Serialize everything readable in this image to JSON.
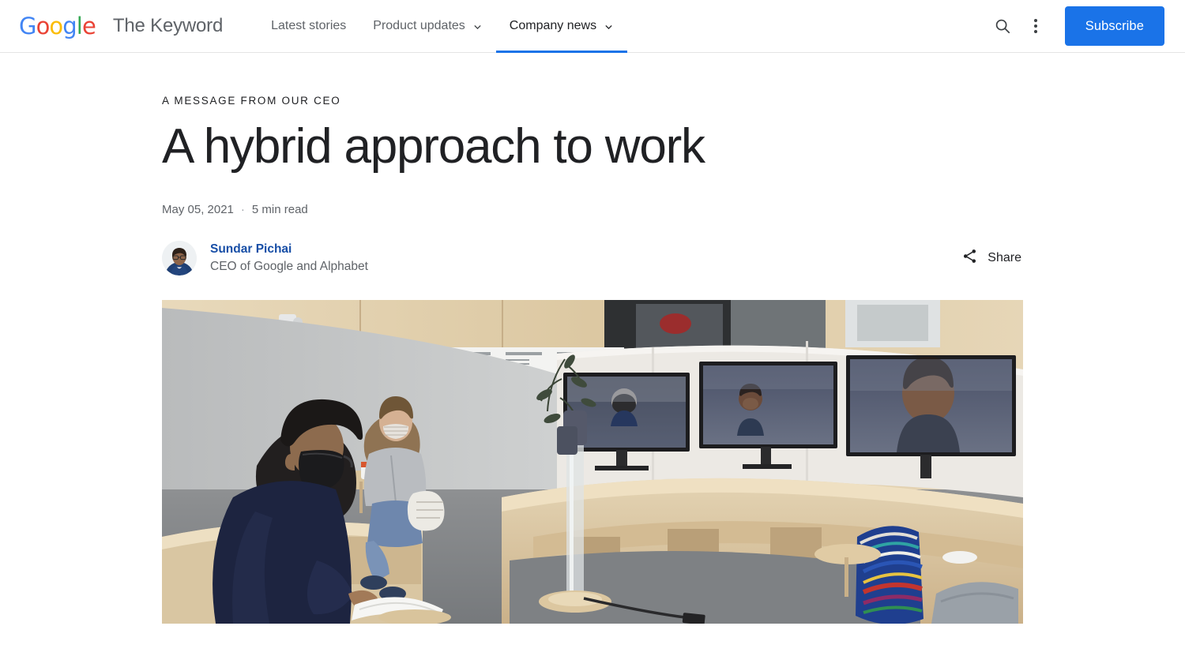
{
  "header": {
    "logo_text": "Google",
    "logo_letters": [
      {
        "ch": "G",
        "color": "#4285F4"
      },
      {
        "ch": "o",
        "color": "#EA4335"
      },
      {
        "ch": "o",
        "color": "#FBBC05"
      },
      {
        "ch": "g",
        "color": "#4285F4"
      },
      {
        "ch": "l",
        "color": "#34A853"
      },
      {
        "ch": "e",
        "color": "#EA4335"
      }
    ],
    "site_title": "The Keyword",
    "nav": [
      {
        "label": "Latest stories",
        "has_chevron": false,
        "active": false
      },
      {
        "label": "Product updates",
        "has_chevron": true,
        "active": false
      },
      {
        "label": "Company news",
        "has_chevron": true,
        "active": true
      }
    ],
    "search_icon": "search-icon",
    "more_icon": "kebab-menu-icon",
    "subscribe_label": "Subscribe",
    "accent_color": "#1a73e8"
  },
  "article": {
    "eyebrow": "A MESSAGE FROM OUR CEO",
    "headline": "A hybrid approach to work",
    "date": "May 05, 2021",
    "separator": "·",
    "read_time": "5 min read",
    "author": {
      "name": "Sundar Pichai",
      "role": "CEO of Google and Alphabet",
      "avatar_alt": "avatar"
    },
    "share_label": "Share",
    "share_icon": "share-icon",
    "hero_alt": "Two people wearing masks seated in a curved wooden Google office meeting space facing three monitors showing remote video-call participants"
  }
}
